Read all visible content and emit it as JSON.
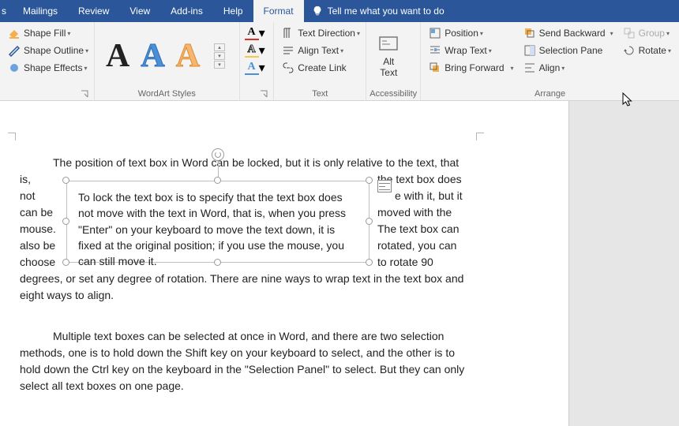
{
  "tabs": {
    "mailings": "Mailings",
    "review": "Review",
    "view": "View",
    "addins": "Add-ins",
    "help": "Help",
    "format": "Format"
  },
  "tellme": "Tell me what you want to do",
  "shapeStyles": {
    "fill": "Shape Fill",
    "outline": "Shape Outline",
    "effects": "Shape Effects"
  },
  "wordart": {
    "label": "WordArt Styles"
  },
  "textgroup": {
    "direction": "Text Direction",
    "align": "Align Text",
    "link": "Create Link",
    "label": "Text"
  },
  "acc": {
    "alt": "Alt\nText",
    "label": "Accessibility"
  },
  "arrange": {
    "position": "Position",
    "wrap": "Wrap Text",
    "forward": "Bring Forward",
    "backward": "Send Backward",
    "pane": "Selection Pane",
    "align": "Align",
    "group": "Group",
    "rotate": "Rotate",
    "label": "Arrange"
  },
  "doc": {
    "p1": "The position of text box in Word can be locked, but it is only relative to the text, that is,",
    "p1r": "the text box does",
    "p2": "not",
    "p2r": "e with it, but it",
    "p3": "can be",
    "p3r": "moved with the",
    "p4": "mouse.",
    "p4r": "The text box can",
    "p5": "also be",
    "p5r": "rotated, you can",
    "p6": "choose",
    "p6r": "to rotate 90",
    "p7": "degrees, or set any degree of rotation. There are nine ways to wrap text in the text box and eight ways to align.",
    "p8": "Multiple text boxes can be selected at once in Word, and there are two selection methods, one is to hold down the Shift key on your keyboard to select, and the other is to hold down the Ctrl key on the keyboard in the \"Selection Panel\" to select. But they can only select all text boxes on one page."
  },
  "textbox": {
    "content": "To lock the text box is to specify that the text box does not move with the text in Word, that is, when you press \"Enter\" on your keyboard to move the text down, it is fixed at the original position; if you use the mouse, you can still move it."
  }
}
